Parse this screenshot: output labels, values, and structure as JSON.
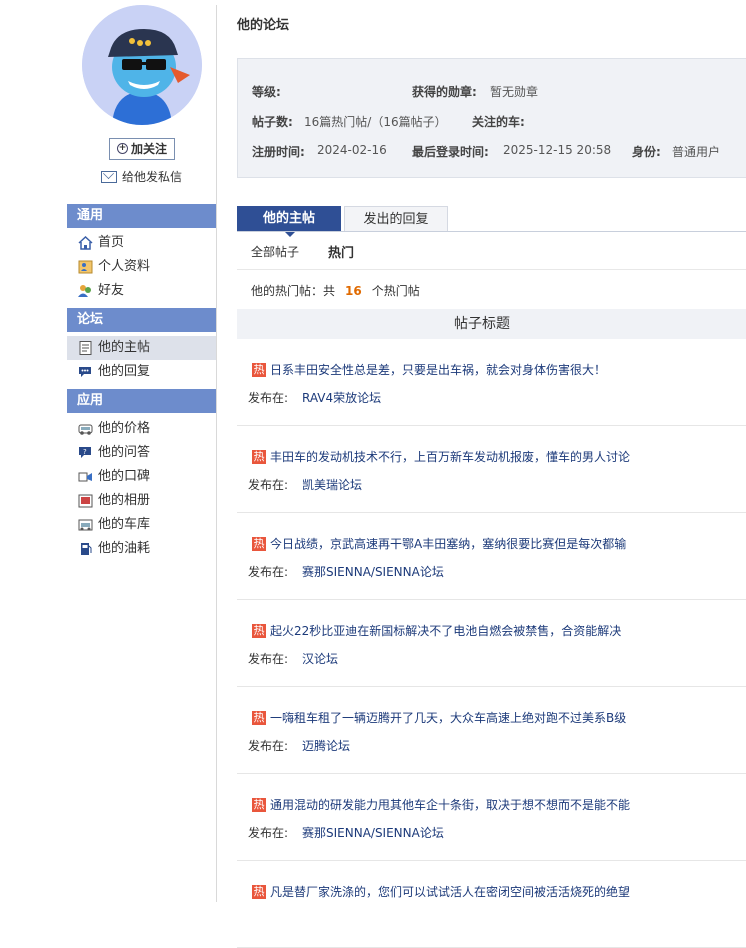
{
  "sidebar": {
    "follow_label": "加关注",
    "message_label": "给他发私信",
    "sections": [
      {
        "title": "通用",
        "items": [
          {
            "label": "首页",
            "icon": "home-icon"
          },
          {
            "label": "个人资料",
            "icon": "profile-icon"
          },
          {
            "label": "好友",
            "icon": "friends-icon"
          }
        ]
      },
      {
        "title": "论坛",
        "items": [
          {
            "label": "他的主帖",
            "icon": "document-icon",
            "active": true
          },
          {
            "label": "他的回复",
            "icon": "comment-icon"
          }
        ]
      },
      {
        "title": "应用",
        "items": [
          {
            "label": "他的价格",
            "icon": "price-icon"
          },
          {
            "label": "他的问答",
            "icon": "question-icon"
          },
          {
            "label": "他的口碑",
            "icon": "review-icon"
          },
          {
            "label": "他的相册",
            "icon": "album-icon"
          },
          {
            "label": "他的车库",
            "icon": "garage-icon"
          },
          {
            "label": "他的油耗",
            "icon": "fuel-icon"
          }
        ]
      }
    ]
  },
  "main": {
    "title": "他的论坛",
    "info": {
      "level_label": "等级:",
      "medal_label": "获得的勋章:",
      "medal_value": "暂无勋章",
      "posts_label": "帖子数:",
      "posts_value": "16篇热门帖/（16篇帖子）",
      "car_label": "关注的车:",
      "register_label": "注册时间:",
      "register_value": "2024-02-16",
      "lastlogin_label": "最后登录时间:",
      "lastlogin_value": "2025-12-15 20:58",
      "identity_label": "身份:",
      "identity_value": "普通用户"
    },
    "tabs": [
      "他的主帖",
      "发出的回复"
    ],
    "subtabs": [
      "全部帖子",
      "热门"
    ],
    "count_prefix": "他的热门帖：共",
    "count_value": "16",
    "count_suffix": "个热门帖",
    "table_header": "帖子标题",
    "hot_badge": "热",
    "posted_in_label": "发布在:",
    "posts": [
      {
        "title": "日系丰田安全性总是差，只要是出车祸，就会对身体伤害很大！",
        "forum": "RAV4荣放论坛"
      },
      {
        "title": "丰田车的发动机技术不行，上百万新车发动机报废，懂车的男人讨论",
        "forum": "凯美瑞论坛"
      },
      {
        "title": "今日战绩，京武高速再干鄂A丰田塞纳，塞纳很要比赛但是每次都输",
        "forum": "赛那SIENNA/SIENNA论坛"
      },
      {
        "title": "起火22秒比亚迪在新国标解决不了电池自燃会被禁售，合资能解决",
        "forum": "汉论坛"
      },
      {
        "title": "一嗨租车租了一辆迈腾开了几天，大众车高速上绝对跑不过美系B级",
        "forum": "迈腾论坛"
      },
      {
        "title": "通用混动的研发能力甩其他车企十条街，取决于想不想而不是能不能",
        "forum": "赛那SIENNA/SIENNA论坛"
      },
      {
        "title": "凡是替厂家洗涤的，您们可以试试活人在密闭空间被活活烧死的绝望",
        "forum": ""
      }
    ]
  },
  "colors": {
    "section_header": "#6d8ccc",
    "tab_active": "#2f4f95",
    "hot_badge": "#e9563c",
    "count_highlight": "#e06a00",
    "link": "#1c3a7a"
  }
}
